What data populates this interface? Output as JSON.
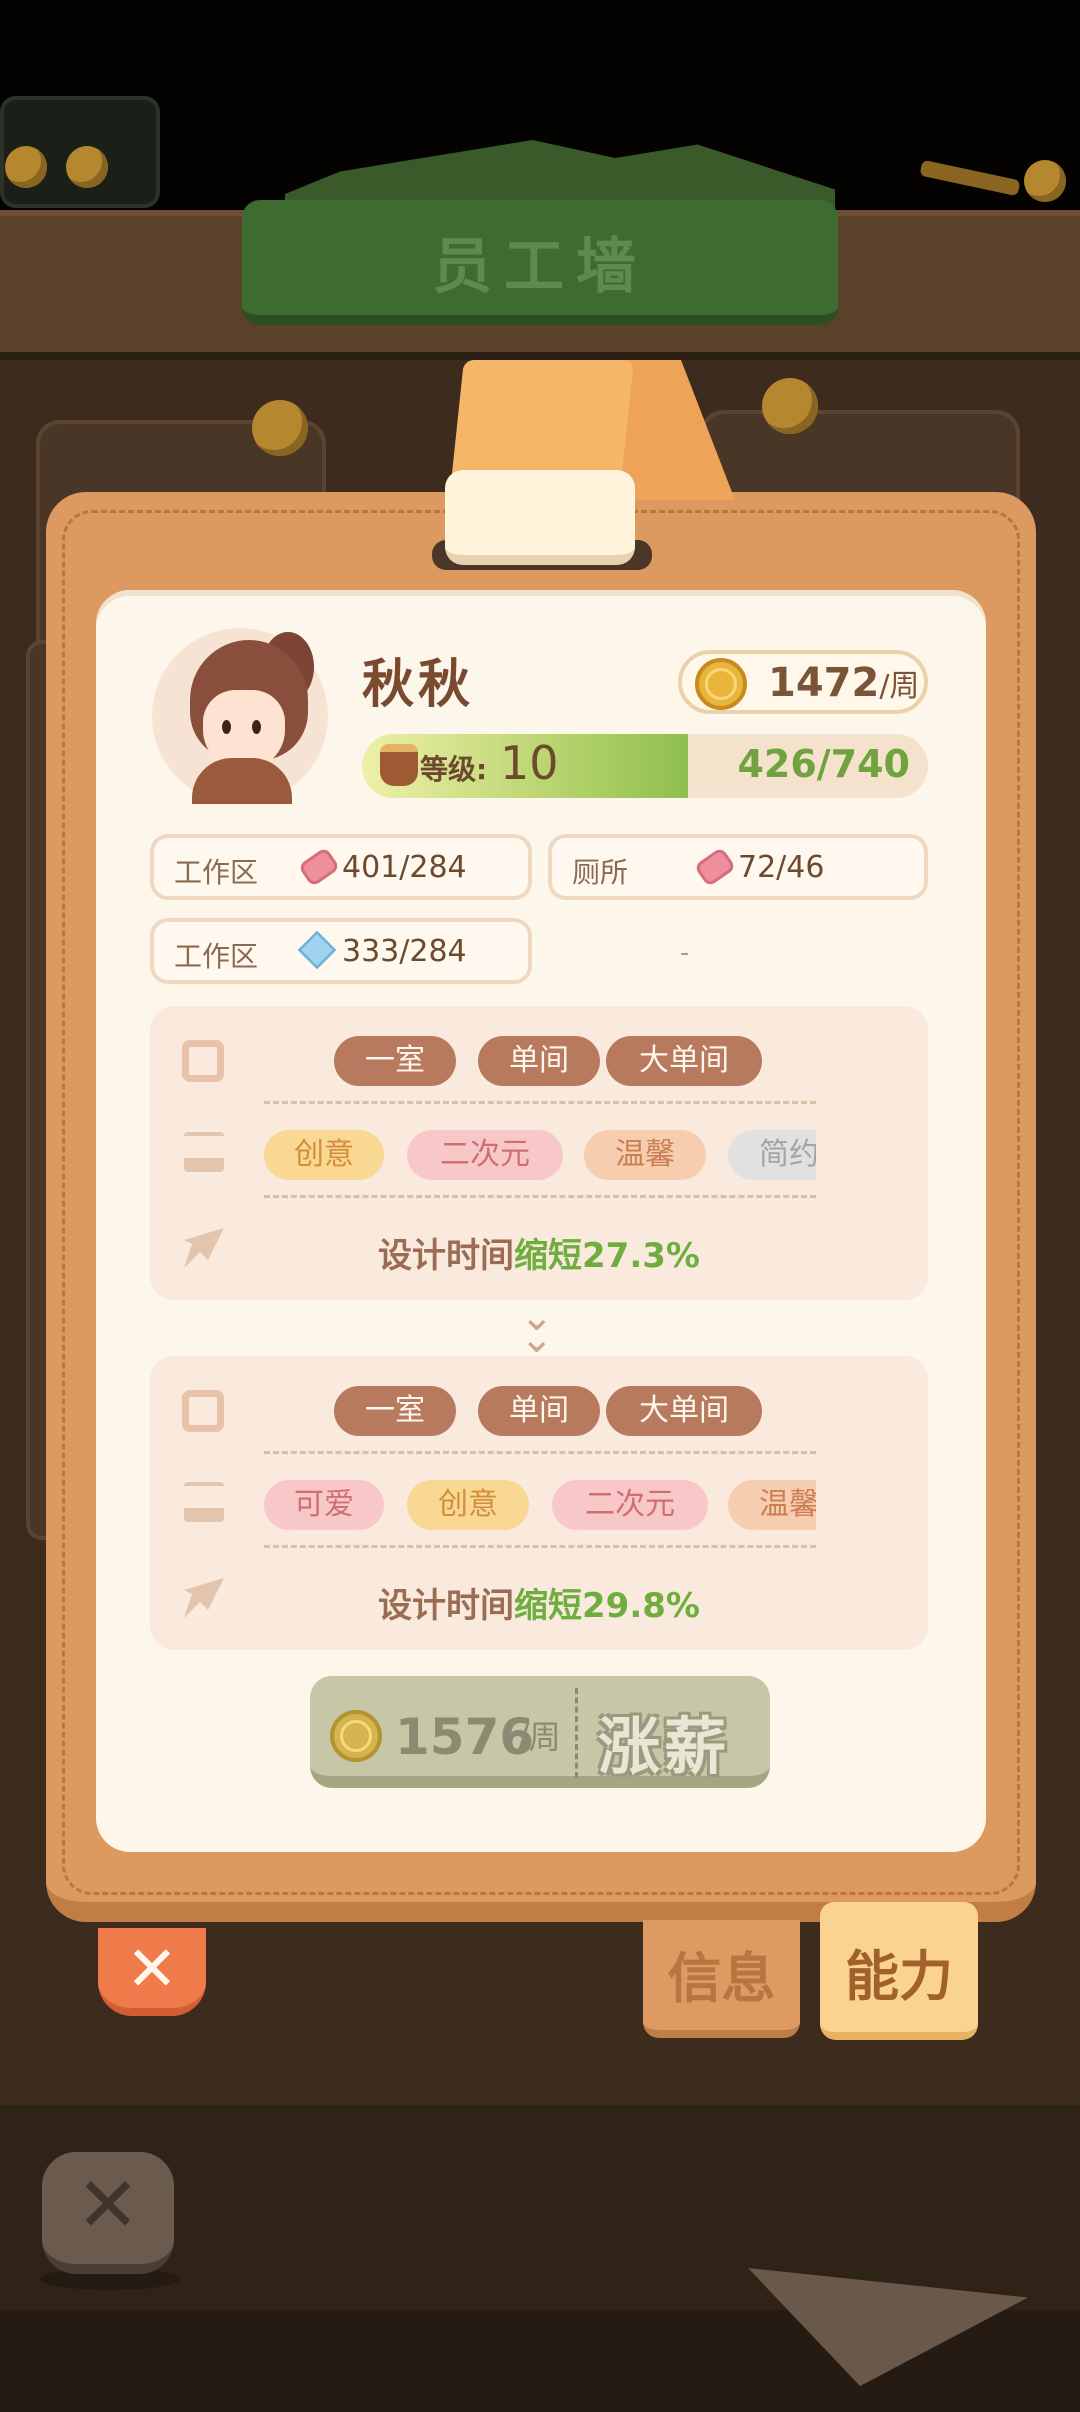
{
  "header": {
    "title": "员工墙"
  },
  "employee": {
    "name": "秋秋",
    "salary": {
      "value": "1472",
      "unit": "/周"
    },
    "level": {
      "label": "等级:",
      "value": "10",
      "exp": "426/740",
      "exp_fraction": 0.576
    }
  },
  "stats": [
    {
      "label": "工作区",
      "value": "401/284",
      "icon": "eraser-icon"
    },
    {
      "label": "厕所",
      "value": "72/46",
      "icon": "eraser-icon"
    },
    {
      "label": "工作区",
      "value": "333/284",
      "icon": "diamond-icon"
    },
    {
      "placeholder": "-"
    }
  ],
  "current_ability": {
    "rooms": [
      "一室",
      "单间",
      "大单间"
    ],
    "styles": [
      "创意",
      "二次元",
      "温馨",
      "简约"
    ],
    "bonus_prefix": "设计时间",
    "bonus_highlight": "缩短27.3%"
  },
  "next_ability": {
    "rooms": [
      "一室",
      "单间",
      "大单间"
    ],
    "styles": [
      "可爱",
      "创意",
      "二次元",
      "温馨"
    ],
    "bonus_prefix": "设计时间",
    "bonus_highlight": "缩短29.8%"
  },
  "raise_button": {
    "cost": "1576",
    "unit": "/周",
    "label": "涨薪"
  },
  "tabs": [
    {
      "label": "信息",
      "active": false
    },
    {
      "label": "能力",
      "active": true
    }
  ],
  "icons": {
    "close": "✕",
    "chevron": "⌄"
  },
  "colors": {
    "accent_green": "#6fae3e",
    "panel": "#fdf6ea",
    "frame": "#dc9a60"
  }
}
